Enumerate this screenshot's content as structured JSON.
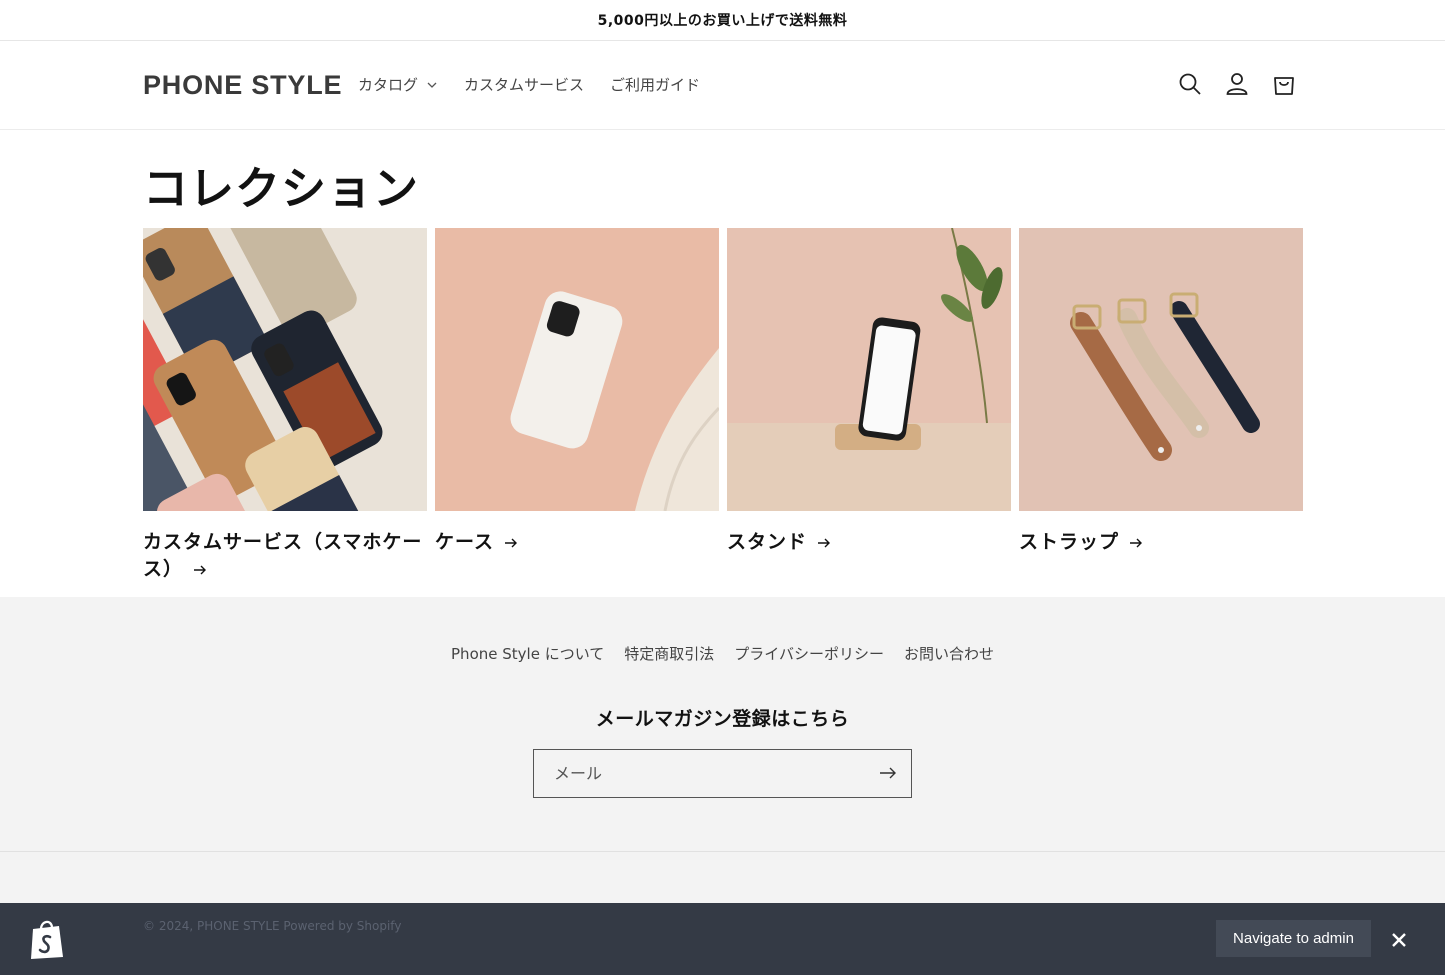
{
  "announcement": "5,000円以上のお買い上げで送料無料",
  "header": {
    "logo": "PHONE STYLE",
    "nav": [
      {
        "label": "カタログ",
        "has_dropdown": true
      },
      {
        "label": "カスタムサービス",
        "has_dropdown": false
      },
      {
        "label": "ご利用ガイド",
        "has_dropdown": false
      }
    ],
    "icons": [
      "search-icon",
      "account-icon",
      "cart-icon"
    ]
  },
  "page": {
    "title": "コレクション"
  },
  "collections": [
    {
      "label": "カスタムサービス（スマホケース）",
      "image": "phone-cases-collage-image"
    },
    {
      "label": "ケース",
      "image": "white-phone-case-image"
    },
    {
      "label": "スタンド",
      "image": "phone-stand-image"
    },
    {
      "label": "ストラップ",
      "image": "leather-straps-image"
    }
  ],
  "footer": {
    "links": [
      "Phone Style について",
      "特定商取引法",
      "プライバシーポリシー",
      "お問い合わせ"
    ],
    "newsletter_title": "メールマガジン登録はこちら",
    "email_placeholder": "メール",
    "copyright": "© 2024, PHONE STYLE Powered by Shopify"
  },
  "admin_bar": {
    "button_label": "Navigate to admin"
  },
  "colors": {
    "footer_bg": "#f3f3f3",
    "admin_bar_bg": "#343a45",
    "text": "#121212"
  }
}
